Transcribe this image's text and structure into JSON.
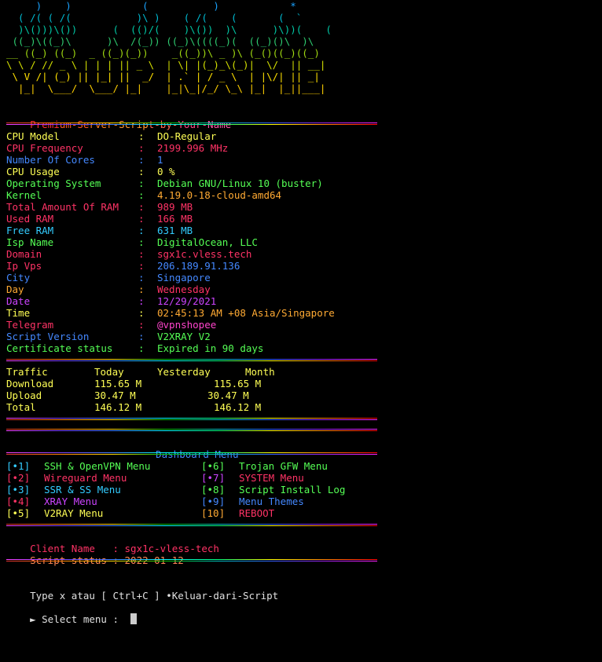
{
  "ascii": [
    {
      "text": "     )    )            (           )            *",
      "color": "#1aa3ff"
    },
    {
      "text": "  ( /( ( /(           )\\ )    ( /(    (       (  `",
      "color": "#00bcd4"
    },
    {
      "text": "  )\\()))\\())      (  (()/(    )\\())  )\\      )\\))(    (",
      "color": "#00c9a7"
    },
    {
      "text": " ((_)\\((_)\\      )\\  /(_)) ((_)\\((((_)(  ((_)()\\  )\\",
      "color": "#2ecc71"
    },
    {
      "text": "__ ((_) ((_)  _ ((_)(_))    _((_))\\ _ )\\ (_()((_)((_)",
      "color": "#a0d911"
    },
    {
      "text": "\\ \\ / // _ \\ | | | || _ \\  | \\| |(_)_\\(_)|  \\/  || __|",
      "color": "#d4e000"
    },
    {
      "text": " \\ V /| (_) || |_| ||  _/  | .` | / _ \\  | |\\/| || _|",
      "color": "#ffe000"
    },
    {
      "text": "  |_|  \\___/  \\___/ |_|    |_|\\_|/_/ \\_\\ |_|  |_||___|",
      "color": "#ffd000"
    }
  ],
  "brand": {
    "text": "Premium-Server-Script-by-Your-Name"
  },
  "sysinfo": [
    {
      "label": "CPU Model",
      "value": "DO-Regular",
      "lcolor": "#ffff55",
      "vcolor": "#ffff55"
    },
    {
      "label": "CPU Frequency",
      "value": "2199.996 MHz",
      "lcolor": "#ff3366",
      "vcolor": "#ff3366"
    },
    {
      "label": "Number Of Cores",
      "value": "1",
      "lcolor": "#4488ff",
      "vcolor": "#4488ff"
    },
    {
      "label": "CPU Usage",
      "value": "0 %",
      "lcolor": "#ffff55",
      "vcolor": "#ffff55"
    },
    {
      "label": "Operating System",
      "value": "Debian GNU/Linux 10 (buster)",
      "lcolor": "#55ff55",
      "vcolor": "#55ff55"
    },
    {
      "label": "Kernel",
      "value": "4.19.0-18-cloud-amd64",
      "lcolor": "#55ff55",
      "vcolor": "#ffaa33"
    },
    {
      "label": "Total Amount Of RAM",
      "value": "989 MB",
      "lcolor": "#ff3366",
      "vcolor": "#ff3366"
    },
    {
      "label": "Used RAM",
      "value": "166 MB",
      "lcolor": "#ff3366",
      "vcolor": "#ff3366"
    },
    {
      "label": "Free RAM",
      "value": "631 MB",
      "lcolor": "#33ccff",
      "vcolor": "#33ccff"
    },
    {
      "label": "Isp Name",
      "value": "DigitalOcean, LLC",
      "lcolor": "#55ff55",
      "vcolor": "#55ff55"
    },
    {
      "label": "Domain",
      "value": "sgx1c.vless.tech",
      "lcolor": "#ff3366",
      "vcolor": "#ff3366"
    },
    {
      "label": "Ip Vps",
      "value": "206.189.91.136",
      "lcolor": "#ff3366",
      "vcolor": "#4488ff"
    },
    {
      "label": "City",
      "value": "Singapore",
      "lcolor": "#4488ff",
      "vcolor": "#4488ff"
    },
    {
      "label": "Day",
      "value": "Wednesday",
      "lcolor": "#ffaa33",
      "vcolor": "#ff3366"
    },
    {
      "label": "Date",
      "value": "12/29/2021",
      "lcolor": "#cc44ff",
      "vcolor": "#cc44ff"
    },
    {
      "label": "Time",
      "value": "02:45:13 AM +08 Asia/Singapore",
      "lcolor": "#ffff55",
      "vcolor": "#ffaa33"
    },
    {
      "label": "Telegram",
      "value": "@vpnshopee",
      "lcolor": "#ff3366",
      "vcolor": "#ff44cc"
    },
    {
      "label": "Script Version",
      "value": "V2XRAY V2",
      "lcolor": "#4488ff",
      "vcolor": "#55ff55"
    },
    {
      "label": "Certificate status",
      "value": "Expired in 90 days",
      "lcolor": "#55ff55",
      "vcolor": "#55ff55"
    }
  ],
  "traffic": {
    "headers": [
      "Traffic",
      "Today",
      "Yesterday",
      "Month"
    ],
    "rows": [
      {
        "label": "Download",
        "today": "115.65 M",
        "yesterday": "",
        "month": "115.65 M"
      },
      {
        "label": "Upload",
        "today": "30.47 M",
        "yesterday": "",
        "month": "30.47 M"
      },
      {
        "label": "Total",
        "today": "146.12 M",
        "yesterday": "",
        "month": "146.12 M"
      }
    ],
    "color": "#ffff55"
  },
  "dashboard": {
    "title": "Dashboard Menu",
    "color": "#4488ff"
  },
  "menu": [
    {
      "key": "[•1]",
      "label": "SSH & OpenVPN Menu",
      "kcolor": "#33ccff",
      "lcolor": "#55ff55"
    },
    {
      "key": "[•2]",
      "label": "Wireguard Menu",
      "kcolor": "#ff3366",
      "lcolor": "#ff3366"
    },
    {
      "key": "[•3]",
      "label": "SSR & SS Menu",
      "kcolor": "#33ccff",
      "lcolor": "#33ccff"
    },
    {
      "key": "[•4]",
      "label": "XRAY Menu",
      "kcolor": "#ff3366",
      "lcolor": "#cc44ff"
    },
    {
      "key": "[•5]",
      "label": "V2RAY Menu",
      "kcolor": "#ffff55",
      "lcolor": "#ffff55"
    },
    {
      "key": "[•6]",
      "label": "Trojan GFW Menu",
      "kcolor": "#55ff55",
      "lcolor": "#55ff55"
    },
    {
      "key": "[•7]",
      "label": "SYSTEM Menu",
      "kcolor": "#cc44ff",
      "lcolor": "#ff3366"
    },
    {
      "key": "[•8]",
      "label": "Script Install Log",
      "kcolor": "#55ff55",
      "lcolor": "#55ff55"
    },
    {
      "key": "[•9]",
      "label": "Menu Themes",
      "kcolor": "#4488ff",
      "lcolor": "#4488ff"
    },
    {
      "key": "[10]",
      "label": "REBOOT",
      "kcolor": "#ffaa33",
      "lcolor": "#ff3366"
    }
  ],
  "client": {
    "name_label": "Client Name   :",
    "name_value": "sgx1c-vless-tech",
    "status_label": "Script status :",
    "status_value": "2022-01-12",
    "name_color": "#ff3366",
    "status_color": "#ff8855"
  },
  "footer": {
    "exit_hint": "Type x atau [ Ctrl+C ] •Keluar-dari-Script",
    "prompt": "► Select menu :",
    "color": "#e0e0e0"
  }
}
